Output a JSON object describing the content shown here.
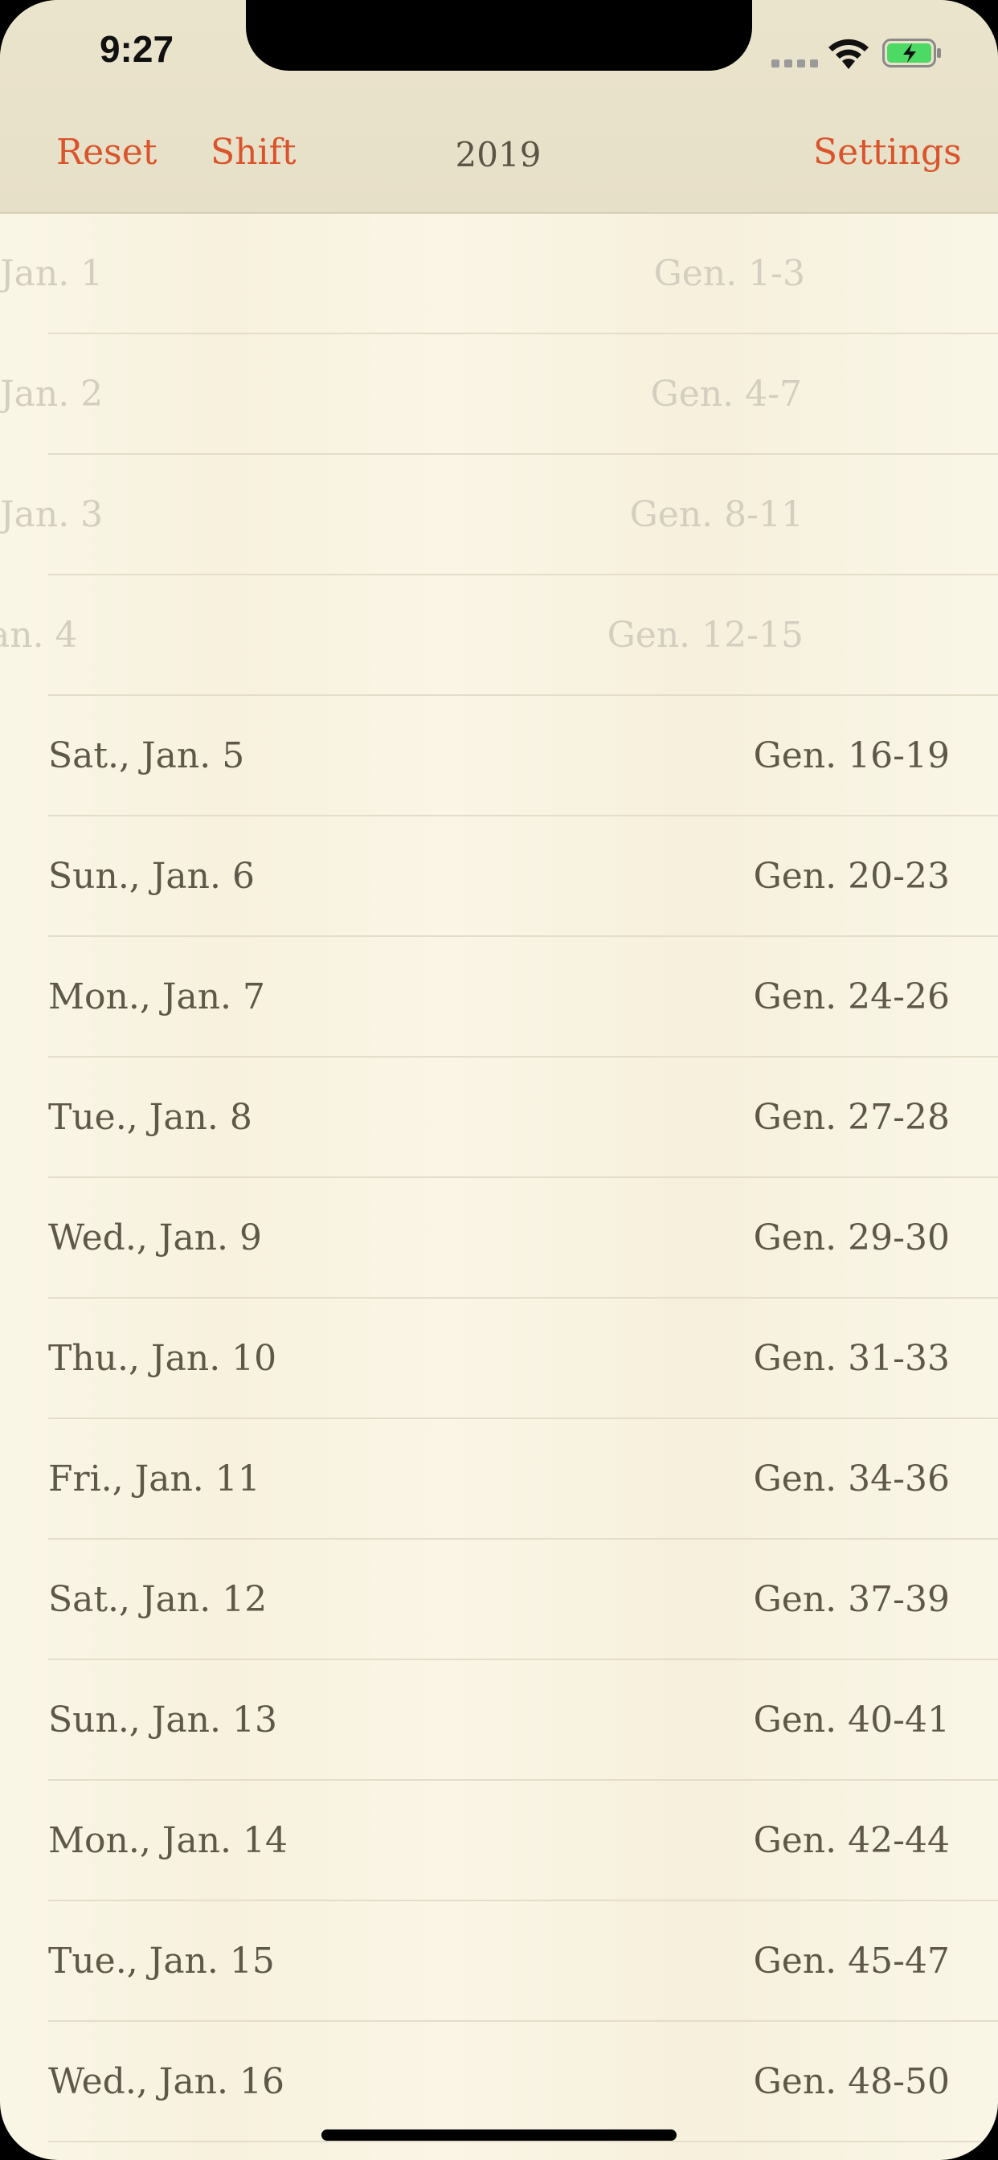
{
  "status": {
    "time": "9:27"
  },
  "nav": {
    "reset_label": "Reset",
    "shift_label": "Shift",
    "title": "2019",
    "settings_label": "Settings"
  },
  "colors": {
    "accent": "#d9542b",
    "text": "#5e5848",
    "faded_text": "#d3cebf",
    "background": "#f8f3e2"
  },
  "readings": [
    {
      "date": "Jan. 1",
      "passage": "Gen. 1-3",
      "completed": true
    },
    {
      "date": "Jan. 2",
      "passage": "Gen. 4-7",
      "completed": true
    },
    {
      "date": "Jan. 3",
      "passage": "Gen. 8-11",
      "completed": true
    },
    {
      "date": "an. 4",
      "passage": "Gen. 12-15",
      "completed": true
    },
    {
      "date": "Sat., Jan. 5",
      "passage": "Gen. 16-19",
      "completed": false
    },
    {
      "date": "Sun., Jan. 6",
      "passage": "Gen. 20-23",
      "completed": false
    },
    {
      "date": "Mon., Jan. 7",
      "passage": "Gen. 24-26",
      "completed": false
    },
    {
      "date": "Tue., Jan. 8",
      "passage": "Gen. 27-28",
      "completed": false
    },
    {
      "date": "Wed., Jan. 9",
      "passage": "Gen. 29-30",
      "completed": false
    },
    {
      "date": "Thu., Jan. 10",
      "passage": "Gen. 31-33",
      "completed": false
    },
    {
      "date": "Fri., Jan. 11",
      "passage": "Gen. 34-36",
      "completed": false
    },
    {
      "date": "Sat., Jan. 12",
      "passage": "Gen. 37-39",
      "completed": false
    },
    {
      "date": "Sun., Jan. 13",
      "passage": "Gen. 40-41",
      "completed": false
    },
    {
      "date": "Mon., Jan. 14",
      "passage": "Gen. 42-44",
      "completed": false
    },
    {
      "date": "Tue., Jan. 15",
      "passage": "Gen. 45-47",
      "completed": false
    },
    {
      "date": "Wed., Jan. 16",
      "passage": "Gen. 48-50",
      "completed": false
    }
  ]
}
